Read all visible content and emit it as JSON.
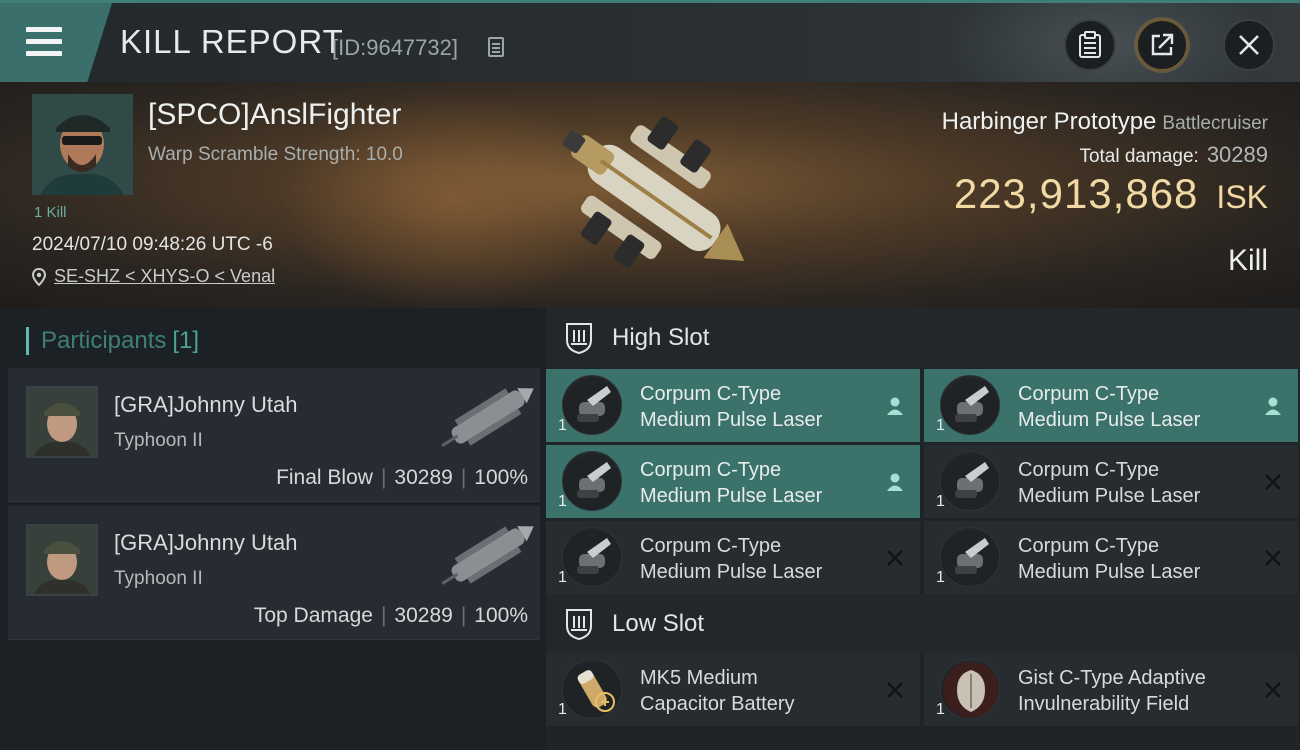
{
  "header": {
    "title": "KILL REPORT",
    "report_id": "[ID:9647732]"
  },
  "victim": {
    "name": "[SPCO]AnslFighter",
    "warp_scramble": "Warp Scramble Strength: 10.0",
    "kills": "1 Kill",
    "timestamp": "2024/07/10 09:48:26 UTC -6",
    "location": "SE-SHZ < XHYS-O < Venal",
    "ship_name": "Harbinger Prototype",
    "ship_class": "Battlecruiser",
    "total_damage_label": "Total damage:",
    "total_damage": "30289",
    "isk_value": "223,913,868",
    "isk_currency": "ISK",
    "report_type": "Kill"
  },
  "participants": {
    "label": "Participants",
    "count": "[1]",
    "items": [
      {
        "name": "[GRA]Johnny Utah",
        "ship": "Typhoon II",
        "role": "Final Blow",
        "damage": "30289",
        "percent": "100%"
      },
      {
        "name": "[GRA]Johnny Utah",
        "ship": "Typhoon II",
        "role": "Top Damage",
        "damage": "30289",
        "percent": "100%"
      }
    ]
  },
  "slots": {
    "high": {
      "label": "High Slot",
      "modules": [
        {
          "qty": "1",
          "line1": "Corpum C-Type",
          "line2": "Medium Pulse Laser",
          "status": "fitted"
        },
        {
          "qty": "1",
          "line1": "Corpum C-Type",
          "line2": "Medium Pulse Laser",
          "status": "fitted"
        },
        {
          "qty": "1",
          "line1": "Corpum C-Type",
          "line2": "Medium Pulse Laser",
          "status": "destroyed"
        },
        {
          "qty": "1",
          "line1": "Corpum C-Type",
          "line2": "Medium Pulse Laser",
          "status": "fitted"
        },
        {
          "qty": "1",
          "line1": "Corpum C-Type",
          "line2": "Medium Pulse Laser",
          "status": "destroyed"
        },
        {
          "qty": "1",
          "line1": "Corpum C-Type",
          "line2": "Medium Pulse Laser",
          "status": "destroyed"
        }
      ]
    },
    "low": {
      "label": "Low Slot",
      "modules": [
        {
          "qty": "1",
          "line1": "MK5 Medium",
          "line2": "Capacitor Battery",
          "status": "destroyed"
        },
        {
          "qty": "1",
          "line1": "Gist C-Type Adaptive",
          "line2": "Invulnerability Field",
          "status": "destroyed"
        }
      ]
    }
  },
  "colors": {
    "accent": "#3c726c",
    "isk_gold": "#f1d9a4",
    "participants_teal": "#3f7f79"
  }
}
